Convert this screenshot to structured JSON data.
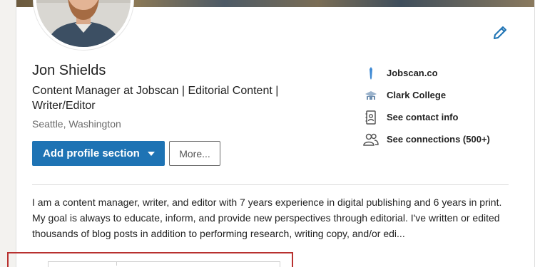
{
  "profile": {
    "name": "Jon Shields",
    "headline": "Content Manager at Jobscan | Editorial Content | Writer/Editor",
    "location": "Seattle, Washington",
    "summary": "I am a content manager, writer, and editor with 7 years experience in digital publishing and 6 years in print. My goal is always to educate, inform, and provide new perspectives through editorial. I've written or edited thousands of blog posts in addition to performing research, writing copy, and/or edi..."
  },
  "actions": {
    "add_profile_section": "Add profile section",
    "more": "More..."
  },
  "sidebar": {
    "items": [
      {
        "label": "Jobscan.co",
        "icon": "jobscan-logo-icon"
      },
      {
        "label": "Clark College",
        "icon": "school-icon"
      },
      {
        "label": "See contact info",
        "icon": "contact-card-icon"
      },
      {
        "label": "See connections (500+)",
        "icon": "connections-icon"
      }
    ]
  },
  "colors": {
    "primary_button": "#1e73b4",
    "edit_icon": "#1e73b4",
    "highlight_border": "#b8312f"
  }
}
